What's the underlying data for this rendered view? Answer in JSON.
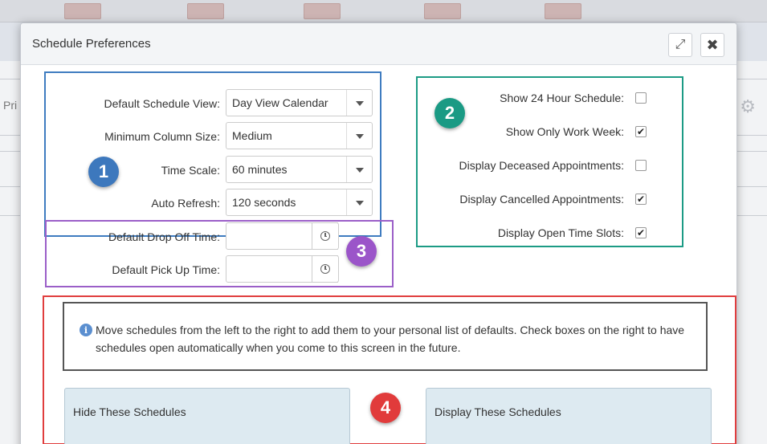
{
  "background": {
    "side_text": "Pri"
  },
  "dialog": {
    "title": "Schedule Preferences",
    "expand_icon": "expand-icon",
    "close_icon": "close-icon"
  },
  "section1": {
    "badge": "1",
    "rows": [
      {
        "label": "Default Schedule View:",
        "value": "Day View Calendar"
      },
      {
        "label": "Minimum Column Size:",
        "value": "Medium"
      },
      {
        "label": "Time Scale:",
        "value": "60 minutes"
      },
      {
        "label": "Auto Refresh:",
        "value": "120 seconds"
      }
    ]
  },
  "section2": {
    "badge": "2",
    "checks": [
      {
        "label": "Show 24 Hour Schedule:",
        "checked": false
      },
      {
        "label": "Show Only Work Week:",
        "checked": true
      },
      {
        "label": "Display Deceased Appointments:",
        "checked": false
      },
      {
        "label": "Display Cancelled Appointments:",
        "checked": true
      },
      {
        "label": "Display Open Time Slots:",
        "checked": true
      }
    ]
  },
  "section3": {
    "badge": "3",
    "rows": [
      {
        "label": "Default Drop Off Time:",
        "value": ""
      },
      {
        "label": "Default Pick Up Time:",
        "value": ""
      }
    ]
  },
  "section4": {
    "badge": "4",
    "info_text": "Move schedules from the left to the right to add them to your personal list of defaults. Check boxes on the right to have schedules open automatically when you come to this screen in the future.",
    "info_icon_glyph": "i",
    "hide_title": "Hide These Schedules",
    "display_title": "Display These Schedules"
  },
  "colors": {
    "section1": "#3f7cc0",
    "section2": "#1c9b85",
    "section3": "#9b5fc8",
    "section4": "#e03e3e"
  }
}
